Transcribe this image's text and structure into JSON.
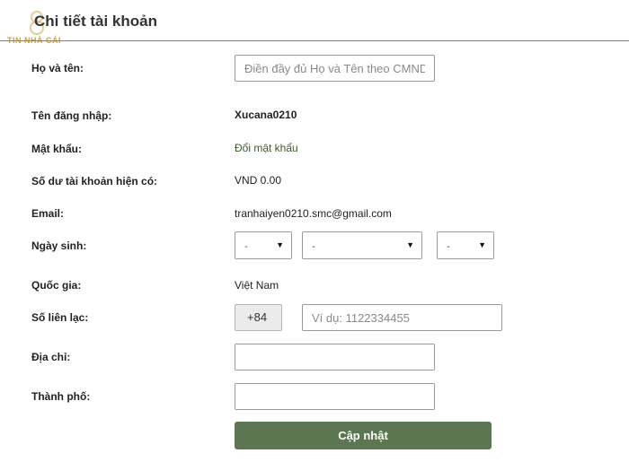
{
  "header": {
    "title": "Chi tiết tài khoản",
    "watermark_text": "TIN NHÀ CÁI"
  },
  "form": {
    "full_name": {
      "label": "Họ và tên:",
      "placeholder": "Điền đầy đủ Họ và Tên theo CMND",
      "value": ""
    },
    "username": {
      "label": "Tên đăng nhập:",
      "value": "Xucana0210"
    },
    "password": {
      "label": "Mật khẩu:",
      "link": "Đổi mật khẩu"
    },
    "balance": {
      "label": "Số dư tài khoản hiện có:",
      "value": "VND 0.00"
    },
    "email": {
      "label": "Email:",
      "value": "tranhaiyen0210.smc@gmail.com"
    },
    "birthday": {
      "label": "Ngày sinh:",
      "day": "-",
      "month": "-",
      "year": "-"
    },
    "country": {
      "label": "Quốc gia:",
      "value": "Việt Nam"
    },
    "phone": {
      "label": "Số liên lạc:",
      "prefix": "+84",
      "placeholder": "Ví dụ: 1122334455",
      "value": ""
    },
    "address": {
      "label": "Địa chỉ:",
      "value": ""
    },
    "city": {
      "label": "Thành phố:",
      "value": ""
    },
    "submit_label": "Cập nhật"
  },
  "colors": {
    "accent": "#5c7652",
    "rule": "#6b8f5e",
    "watermark": "#c9a24a"
  }
}
